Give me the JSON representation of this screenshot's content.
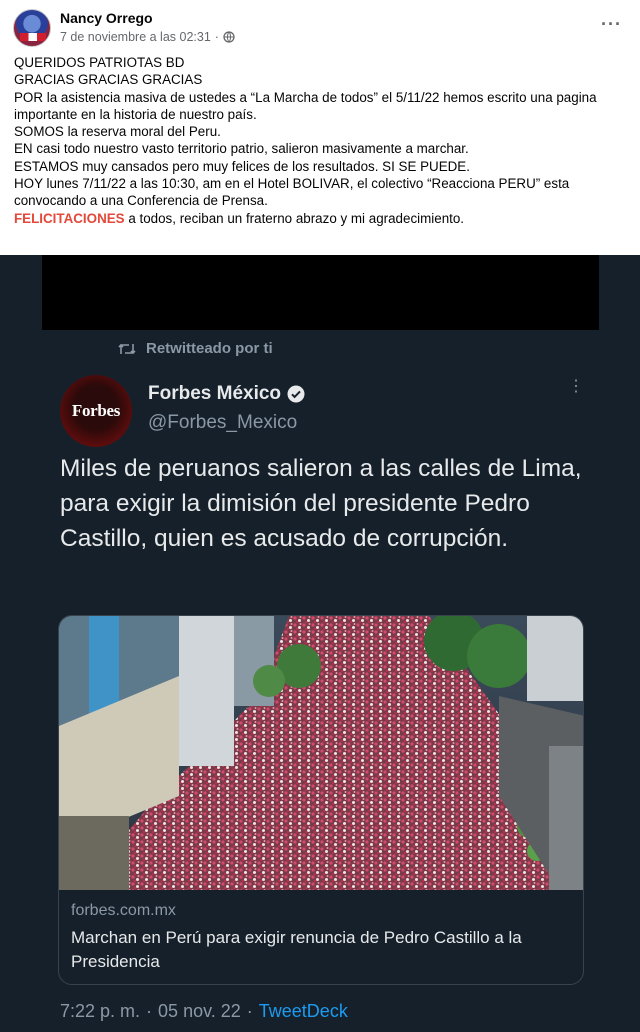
{
  "post": {
    "author": "Nancy Orrego",
    "timestamp": "7 de noviembre a las 02:31",
    "separator": "·",
    "more_label": "···",
    "lines": [
      "QUERIDOS PATRIOTAS BD",
      "GRACIAS GRACIAS GRACIAS",
      "POR la asistencia masiva de ustedes a “La Marcha de todos” el 5/11/22 hemos escrito una pagina importante en la historia de nuestro país.",
      "SOMOS la reserva moral del Peru.",
      "EN casi todo nuestro vasto territorio patrio, salieron masivamente a marchar.",
      "ESTAMOS muy cansados pero muy felices de los resultados. SI SE PUEDE.",
      "HOY lunes 7/11/22 a las 10:30, am en el Hotel BOLIVAR, el colectivo “Reacciona PERU”  esta convocando a una Conferencia de Prensa."
    ],
    "last_line_highlight": "FELICITACIONES",
    "last_line_rest": " a todos, reciban un fraterno abrazo y mi agradecimiento."
  },
  "tweet": {
    "retweet_label": "Retwitteado por ti",
    "avatar_text": "Forbes",
    "account_name": "Forbes México",
    "account_handle": "@Forbes_Mexico",
    "more_label": "⋮",
    "text": "Miles de peruanos salieron a las calles de Lima, para exigir la dimisión del presidente Pedro Castillo, quien es acusado de corrupción.",
    "card": {
      "domain": "forbes.com.mx",
      "title": "Marchan en Perú para exigir renuncia de Pedro Castillo a la Presidencia"
    },
    "time": "7:22 p. m.",
    "date": "05 nov. 22",
    "separator": "·",
    "source": "TweetDeck"
  },
  "colors": {
    "accent": "#e3483a",
    "tweet_bg": "#15202b",
    "link_blue": "#1d9bf0",
    "verified": "#e7e9ea"
  },
  "icons": [
    "globe-icon",
    "more-icon",
    "retweet-icon",
    "verified-icon",
    "tweet-more-icon"
  ]
}
